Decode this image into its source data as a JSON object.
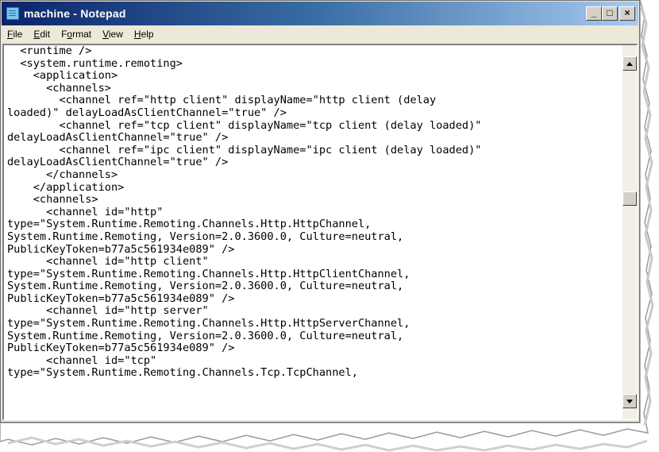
{
  "window": {
    "title": "machine - Notepad",
    "app_icon": "notepad-icon",
    "buttons": {
      "minimize": "_",
      "maximize": "□",
      "close": "×"
    }
  },
  "menu": [
    {
      "accel": "F",
      "rest": "ile"
    },
    {
      "accel": "E",
      "rest": "dit"
    },
    {
      "pre": "F",
      "accel": "o",
      "rest": "rmat"
    },
    {
      "accel": "V",
      "rest": "iew"
    },
    {
      "accel": "H",
      "rest": "elp"
    }
  ],
  "document": {
    "lines": [
      "  <runtime />",
      "  <system.runtime.remoting>",
      "    <application>",
      "      <channels>",
      "        <channel ref=\"http client\" displayName=\"http client (delay",
      "loaded)\" delayLoadAsClientChannel=\"true\" />",
      "        <channel ref=\"tcp client\" displayName=\"tcp client (delay loaded)\"",
      "delayLoadAsClientChannel=\"true\" />",
      "        <channel ref=\"ipc client\" displayName=\"ipc client (delay loaded)\"",
      "delayLoadAsClientChannel=\"true\" />",
      "      </channels>",
      "    </application>",
      "    <channels>",
      "      <channel id=\"http\"",
      "type=\"System.Runtime.Remoting.Channels.Http.HttpChannel,",
      "System.Runtime.Remoting, Version=2.0.3600.0, Culture=neutral,",
      "PublicKeyToken=b77a5c561934e089\" />",
      "      <channel id=\"http client\"",
      "type=\"System.Runtime.Remoting.Channels.Http.HttpClientChannel,",
      "System.Runtime.Remoting, Version=2.0.3600.0, Culture=neutral,",
      "PublicKeyToken=b77a5c561934e089\" />",
      "      <channel id=\"http server\"",
      "type=\"System.Runtime.Remoting.Channels.Http.HttpServerChannel,",
      "System.Runtime.Remoting, Version=2.0.3600.0, Culture=neutral,",
      "PublicKeyToken=b77a5c561934e089\" />",
      "      <channel id=\"tcp\"",
      "type=\"System.Runtime.Remoting.Channels.Tcp.TcpChannel,"
    ]
  },
  "scrollbar": {
    "up_icon": "arrow-up-icon",
    "down_icon": "arrow-down-icon"
  }
}
